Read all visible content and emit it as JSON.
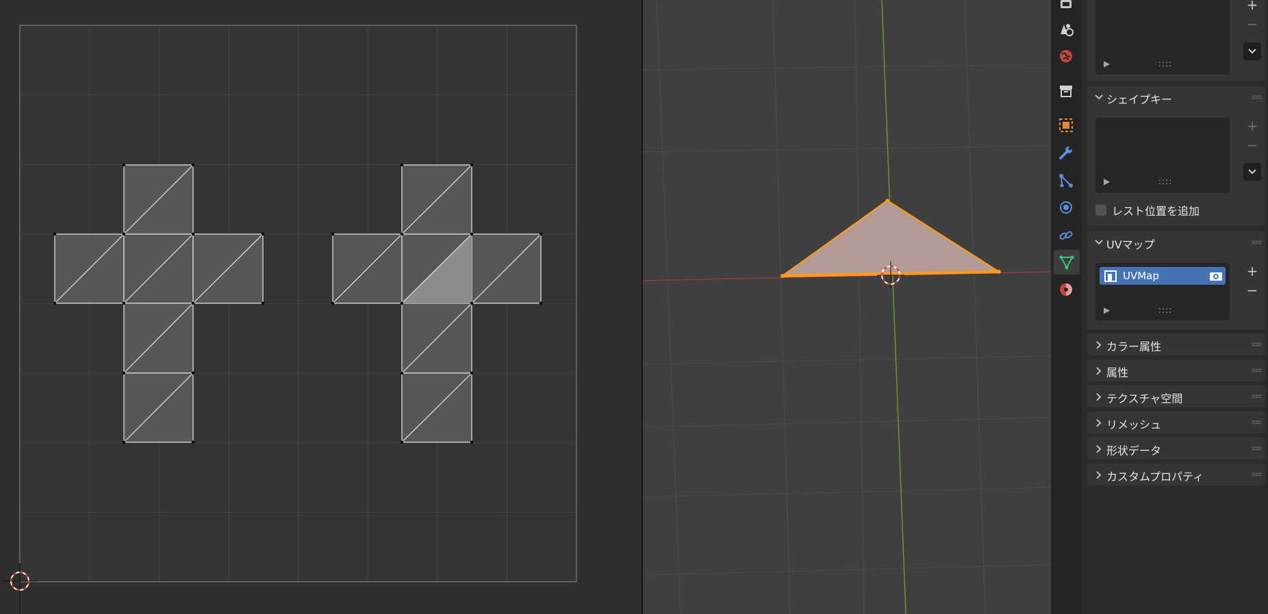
{
  "properties": {
    "shape_keys": {
      "title": "シェイプキー",
      "relative_label": "レスト位置を追加"
    },
    "uv_maps": {
      "title": "UVマップ",
      "items": [
        {
          "name": "UVMap"
        }
      ]
    },
    "sections": [
      {
        "label": "カラー属性"
      },
      {
        "label": "属性"
      },
      {
        "label": "テクスチャ空間"
      },
      {
        "label": "リメッシュ"
      },
      {
        "label": "形状データ"
      },
      {
        "label": "カスタムプロパティ"
      }
    ],
    "list_controls": {
      "add": "+",
      "remove": "−",
      "expand": "▶"
    }
  },
  "tabs": [
    {
      "icon": "output-icon"
    },
    {
      "icon": "scene-icon"
    },
    {
      "icon": "world-icon"
    },
    {
      "icon": "collection-icon"
    },
    {
      "icon": "object-icon"
    },
    {
      "icon": "modifier-wrench-icon"
    },
    {
      "icon": "particles-icon"
    },
    {
      "icon": "physics-icon"
    },
    {
      "icon": "constraints-icon"
    },
    {
      "icon": "mesh-data-icon",
      "active": true
    },
    {
      "icon": "material-icon"
    }
  ],
  "colors": {
    "selection_orange": "#ff9a1e",
    "uv_selected_face": "#8c8c8c",
    "active_list_item": "#4772b3",
    "x_axis": "#b04040",
    "y_axis": "#7a9e2c"
  }
}
